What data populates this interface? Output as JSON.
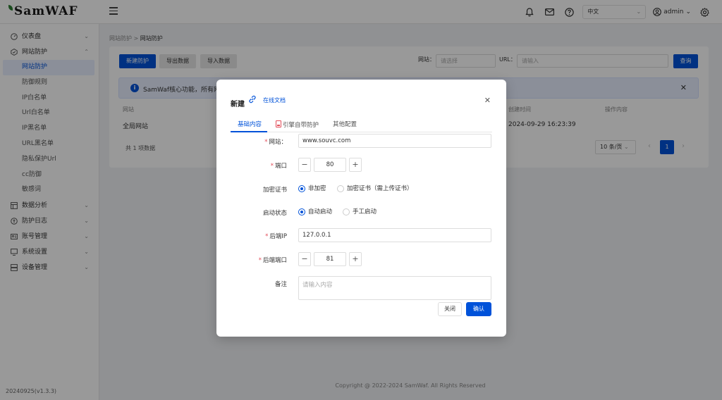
{
  "app": {
    "logo": "SamWAF",
    "version": "20240925(v1.3.3)",
    "copyright": "Copyright @ 2022-2024 SamWaf. All Rights Reserved"
  },
  "header": {
    "language": "中文",
    "user": "admin",
    "icons": [
      "bell-icon",
      "mail-icon",
      "help-icon",
      "user-icon",
      "settings-icon"
    ]
  },
  "sidebar": {
    "groups": [
      {
        "label": "仪表盘",
        "icon": "dashboard-icon",
        "expanded": false
      },
      {
        "label": "网站防护",
        "icon": "shield-icon",
        "expanded": true
      },
      {
        "label": "数据分析",
        "icon": "chart-icon",
        "expanded": false
      },
      {
        "label": "防护日志",
        "icon": "log-icon",
        "expanded": false
      },
      {
        "label": "账号管理",
        "icon": "account-icon",
        "expanded": false
      },
      {
        "label": "系统设置",
        "icon": "system-icon",
        "expanded": false
      },
      {
        "label": "设备管理",
        "icon": "device-icon",
        "expanded": false
      }
    ],
    "sub_items": [
      "网站防护",
      "防御规则",
      "IP白名单",
      "Url白名单",
      "IP黑名单",
      "URL黑名单",
      "隐私保护Url",
      "cc防御",
      "敏感词"
    ],
    "active_sub": "网站防护"
  },
  "breadcrumb": {
    "parent": "网站防护",
    "separator": ">",
    "current": "网站防护"
  },
  "toolbar": {
    "new_label": "新建防护",
    "export_label": "导出数据",
    "import_label": "导入数据",
    "website_label": "网站：",
    "website_placeholder": "请选择",
    "url_label": "URL：",
    "url_placeholder": "请输入",
    "query_label": "查询"
  },
  "notice": {
    "text": "SamWaf核心功能，所有网站"
  },
  "table": {
    "columns": [
      "网站",
      "创建时间",
      "操作内容"
    ],
    "rows": [
      {
        "site": "全局网站",
        "created": "2024-09-29 16:23:39"
      }
    ],
    "total": "共 1 项数据",
    "page_size": "10 条/页",
    "current_page": "1"
  },
  "dialog": {
    "title": "新建",
    "doc_link": "在线文档",
    "tabs": [
      "基础内容",
      "引擎自带防护",
      "其他配置"
    ],
    "active_tab": 0,
    "fields": {
      "website_label": "网站：",
      "website_value": "www.souvc.com",
      "port_label": "端口",
      "port_value": "80",
      "ssl_label": "加密证书",
      "ssl_options": [
        "非加密",
        "加密证书（需上传证书）"
      ],
      "ssl_selected": 0,
      "status_label": "启动状态",
      "status_options": [
        "自动启动",
        "手工启动"
      ],
      "status_selected": 0,
      "backend_ip_label": "后端IP",
      "backend_ip_value": "127.0.0.1",
      "backend_port_label": "后端端口",
      "backend_port_value": "81",
      "remark_label": "备注",
      "remark_placeholder": "请输入内容"
    },
    "stepper_minus": "−",
    "stepper_plus": "+",
    "close_label": "关闭",
    "confirm_label": "确认"
  },
  "colors": {
    "primary": "#0052d9",
    "required": "#e34d59",
    "overlay": "rgba(0,0,0,0.4)"
  }
}
